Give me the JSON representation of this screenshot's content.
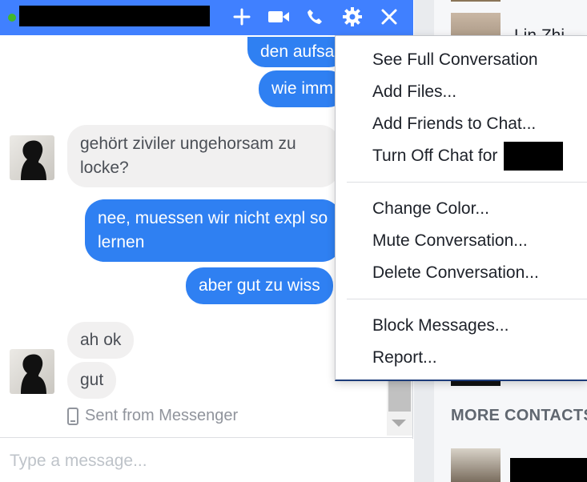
{
  "header": {
    "add_icon": "plus-icon",
    "video_icon": "video-camera-icon",
    "call_icon": "phone-icon",
    "settings_icon": "gear-icon",
    "close_icon": "close-icon",
    "accent_color": "#4080ff"
  },
  "messages": [
    {
      "direction": "out",
      "text": "den aufsa"
    },
    {
      "direction": "out",
      "text": "wie imm"
    },
    {
      "direction": "in",
      "text": "gehört ziviler ungehorsam zu locke?"
    },
    {
      "direction": "out",
      "text": "nee, muessen wir nicht expl so lernen"
    },
    {
      "direction": "out",
      "text": "aber gut zu wiss"
    },
    {
      "direction": "in",
      "text": "ah ok"
    },
    {
      "direction": "in",
      "text": "gut"
    }
  ],
  "sent_from": "Sent from Messenger",
  "composer": {
    "placeholder": "Type a message..."
  },
  "menu": {
    "groups": [
      [
        "See Full Conversation",
        "Add Files...",
        "Add Friends to Chat...",
        "Turn Off Chat for"
      ],
      [
        "Change Color...",
        "Mute Conversation...",
        "Delete Conversation..."
      ],
      [
        "Block Messages...",
        "Report..."
      ]
    ]
  },
  "sidebar": {
    "contact_name": "Lin Zhi",
    "more_contacts": "MORE CONTACTS"
  }
}
